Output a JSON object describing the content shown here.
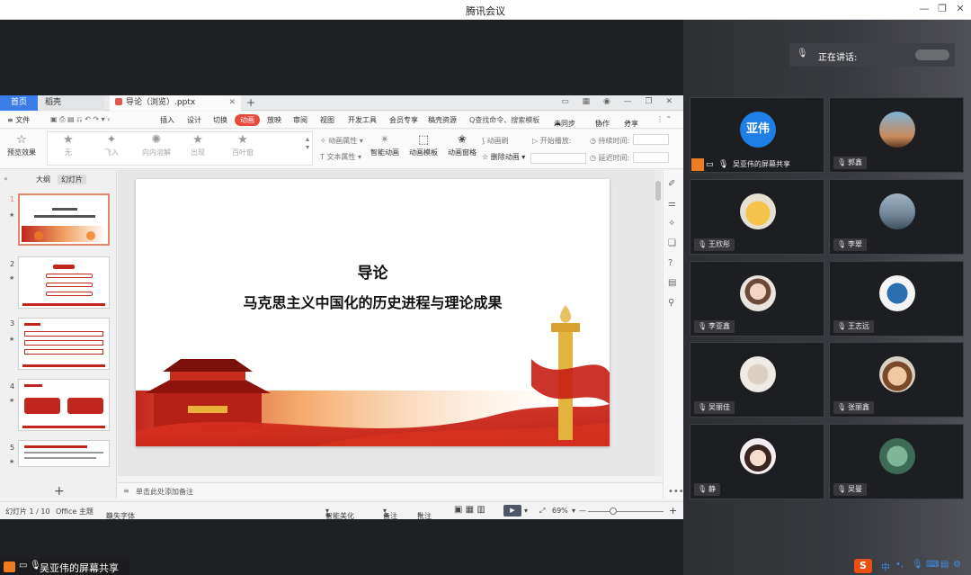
{
  "window": {
    "title": "腾讯会议"
  },
  "wps": {
    "tabs": {
      "home": "首页",
      "daoke": "稻壳",
      "doc": "导论（浏览）.pptx"
    },
    "menu": {
      "file": "≡ 文件",
      "items": [
        "插入",
        "设计",
        "切换",
        "动画",
        "放映",
        "审阅",
        "视图",
        "开发工具",
        "会员专享",
        "稿壳资源"
      ],
      "active": "动画",
      "search": "Q查找命令、搜索模板",
      "unsync": "未同步",
      "collab": "协作",
      "share": "分享"
    },
    "ribbon": {
      "preview": "预览效果",
      "effects": [
        "无",
        "飞入",
        "向内溶解",
        "出现",
        "百叶窗"
      ],
      "anim_attr": "动画属性",
      "text_attr": "文本属性",
      "smart_anim": "智能动画",
      "anim_template": "动画模板",
      "anim_window": "动画窗格",
      "anim_brush": "动画刷",
      "remove_anim": "删除动画",
      "start_play": "开始播放:",
      "duration": "持续时间:",
      "delay": "延迟时间:"
    },
    "leftpanel": {
      "tab_outline": "大纲",
      "tab_slides": "幻灯片",
      "slide_numbers": [
        "1",
        "2",
        "3",
        "4",
        "5"
      ],
      "add": "+"
    },
    "slide": {
      "title": "导论",
      "subtitle": "马克思主义中国化的历史进程与理论成果"
    },
    "notes_placeholder": "单击此处添加备注",
    "status": {
      "slide_count": "幻灯片 1 / 10",
      "theme": "Office 主题",
      "missing_font": "缺失字体",
      "smart_beautify": "智能美化",
      "notes": "备注",
      "comments": "批注",
      "zoom": "69%"
    }
  },
  "sharing_label": "吴亚伟的屏幕共享",
  "panel": {
    "speaking_label": "正在讲话:",
    "tiles": [
      {
        "name": "吴亚伟的屏幕共享",
        "avatar_text": "亚伟"
      },
      {
        "name": "郭鑫"
      },
      {
        "name": "王欣彤"
      },
      {
        "name": "李翠"
      },
      {
        "name": "李亚鑫"
      },
      {
        "name": "王志远"
      },
      {
        "name": "吴丽佳"
      },
      {
        "name": "张丽鑫"
      },
      {
        "name": "静"
      },
      {
        "name": "吴曼"
      }
    ]
  },
  "tray": {
    "ime": "S",
    "lang": "中"
  },
  "colors": {
    "accent_blue": "#1f7fe6",
    "wps_red": "#e8493b",
    "share_orange": "#f07c22"
  }
}
